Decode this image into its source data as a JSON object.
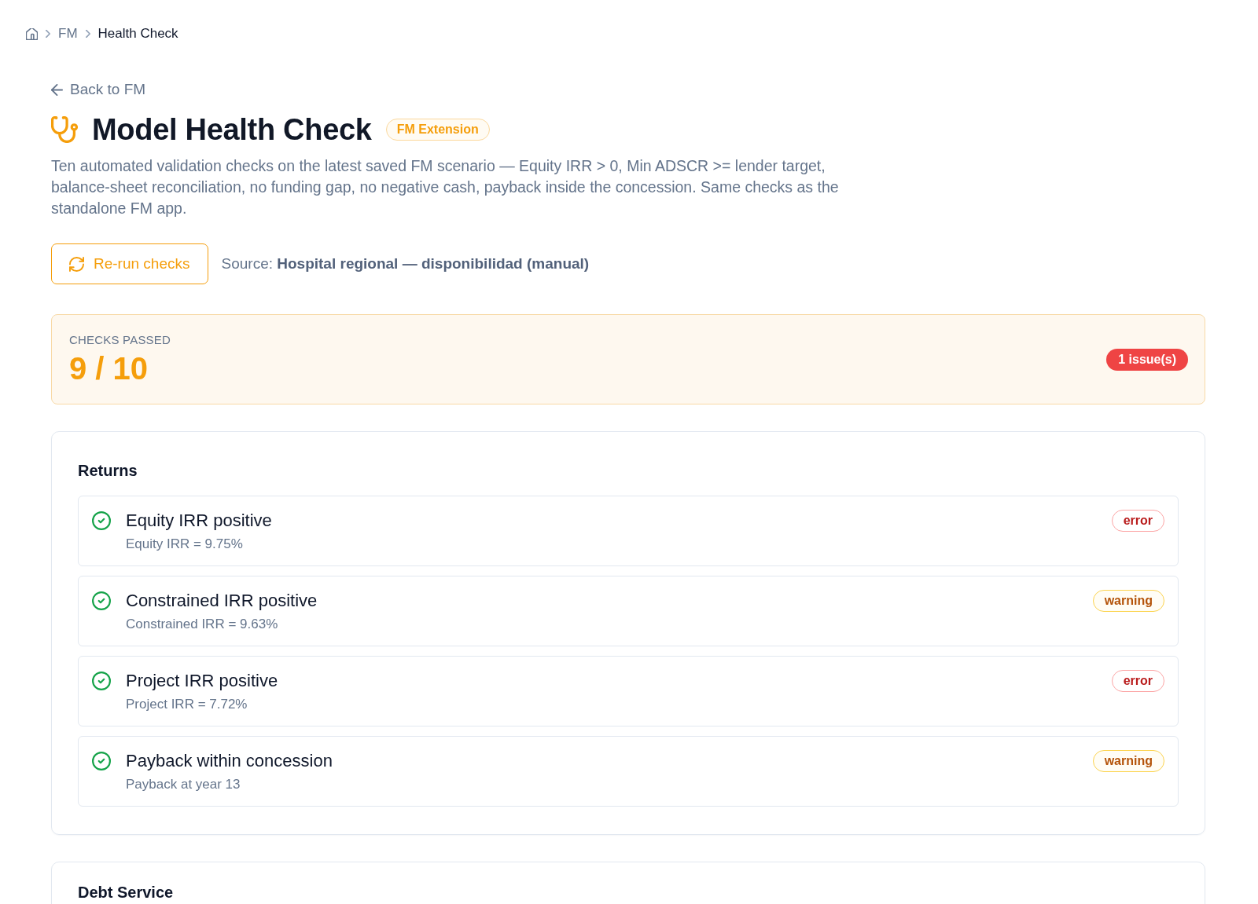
{
  "breadcrumb": [
    {
      "label": "FM",
      "current": false
    },
    {
      "label": "Health Check",
      "current": true
    }
  ],
  "back_link": "Back to FM",
  "header": {
    "title": "Model Health Check",
    "badge": "FM Extension",
    "description": "Ten automated validation checks on the latest saved FM scenario — Equity IRR > 0, Min ADSCR >= lender target, balance-sheet reconciliation, no funding gap, no negative cash, payback inside the concession. Same checks as the standalone FM app."
  },
  "actions": {
    "button": "Re-run checks",
    "source": "Source: **Hospital regional — disponibilidad (manual)**"
  },
  "summary": {
    "label": "CHECKS PASSED",
    "value": "9 / 10",
    "issues": "1 issue(s)"
  },
  "sections": [
    {
      "title": "Returns",
      "checks": [
        {
          "name": "Equity IRR positive",
          "detail": "Equity IRR = 9.75%",
          "passed": true,
          "badge": {
            "label": "error",
            "kind": "error"
          }
        },
        {
          "name": "Constrained IRR positive",
          "detail": "Constrained IRR = 9.63%",
          "passed": true,
          "badge": {
            "label": "warning",
            "kind": "warning"
          }
        },
        {
          "name": "Project IRR positive",
          "detail": "Project IRR = 7.72%",
          "passed": true,
          "badge": {
            "label": "error",
            "kind": "error"
          }
        },
        {
          "name": "Payback within concession",
          "detail": "Payback at year 13",
          "passed": true,
          "badge": {
            "label": "warning",
            "kind": "warning"
          }
        }
      ]
    },
    {
      "title": "Debt Service"
    }
  ]
}
